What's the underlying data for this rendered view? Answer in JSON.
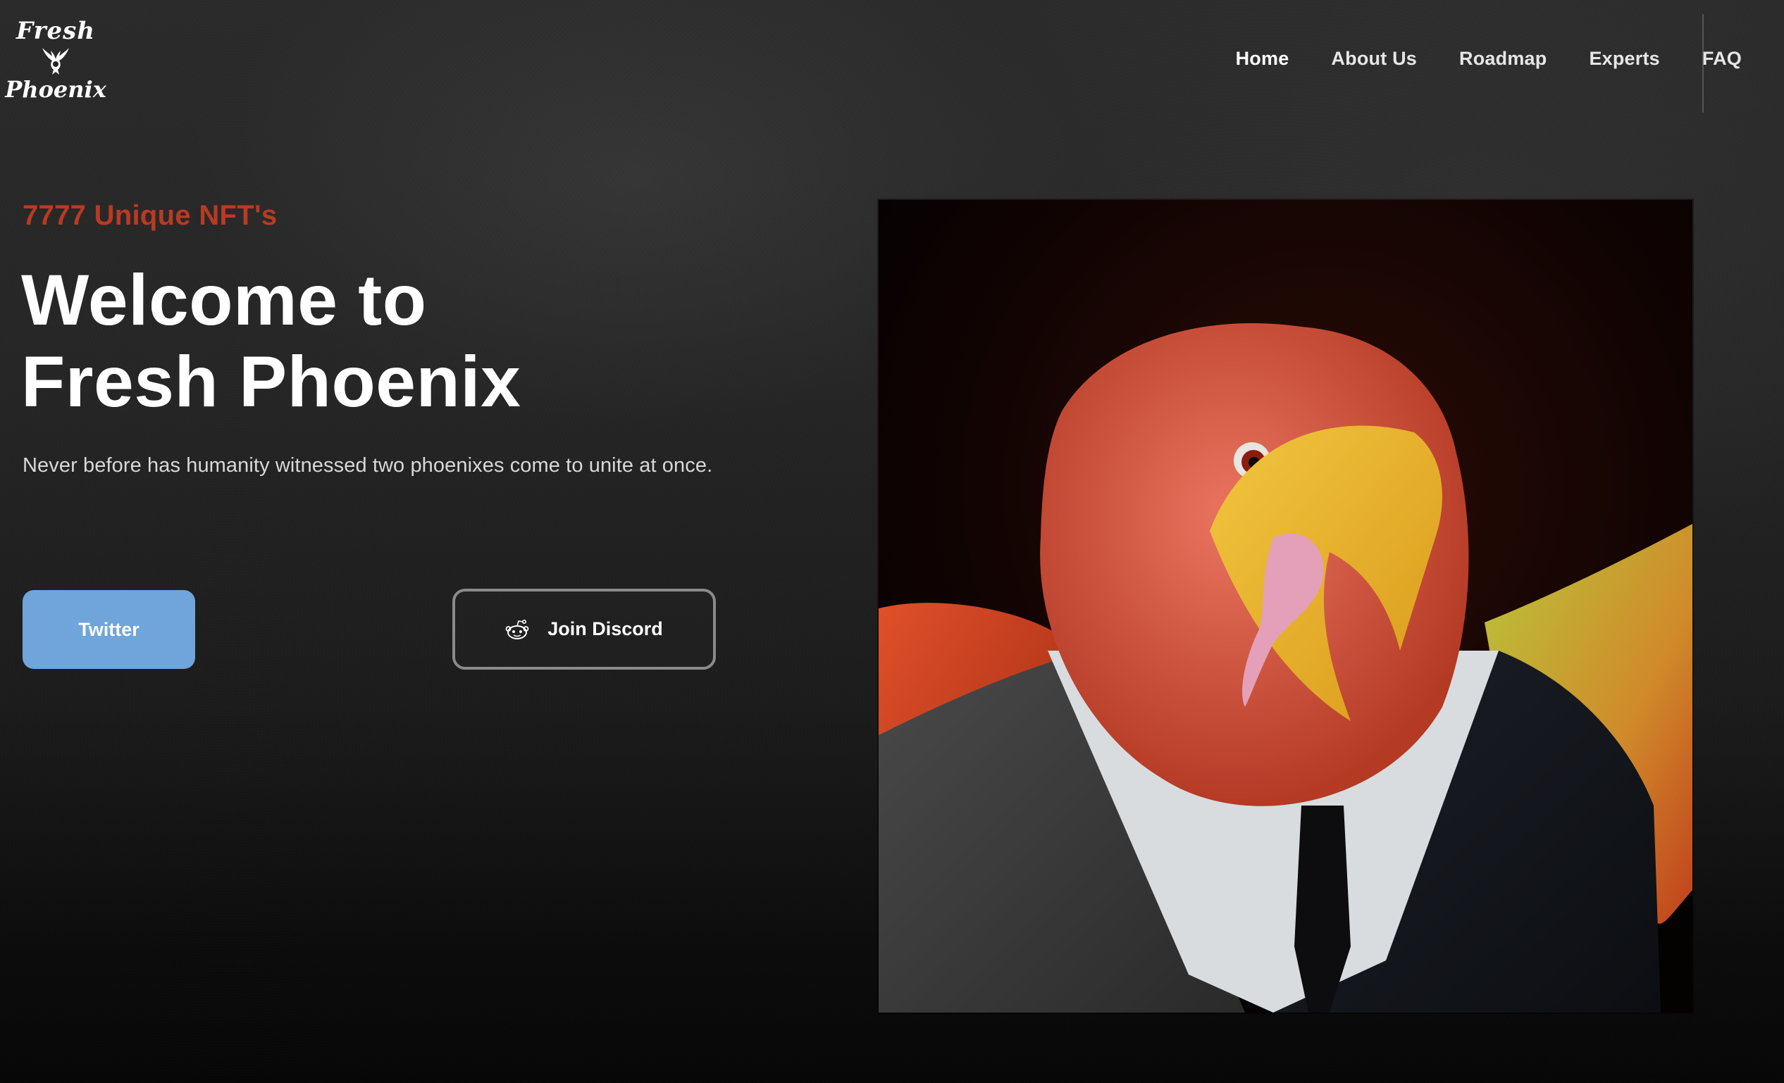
{
  "brand": {
    "logo_line1": "Fresh",
    "logo_line2": "Phoenix",
    "logo_icon": "phoenix-emblem-icon"
  },
  "nav": {
    "items": [
      {
        "label": "Home",
        "active": true
      },
      {
        "label": "About Us",
        "active": false
      },
      {
        "label": "Roadmap",
        "active": false
      },
      {
        "label": "Experts",
        "active": false
      },
      {
        "label": "FAQ",
        "active": false
      }
    ]
  },
  "hero": {
    "eyebrow": "7777 Unique NFT's",
    "headline_line1": "Welcome to",
    "headline_line2": "Fresh Phoenix",
    "subtitle": "Never before has humanity witnessed two phoenixes come to unite at once.",
    "buttons": {
      "twitter_label": "Twitter",
      "discord_label": "Join Discord",
      "discord_icon": "reddit-alien-icon"
    },
    "image_alt": "3D phoenix character with red feathers and yellow beak wearing a black suit and tie"
  },
  "colors": {
    "accent_red": "#b93a23",
    "twitter_blue": "#6fa5da",
    "discord_border": "#8a8a8a",
    "background": "#262626"
  }
}
